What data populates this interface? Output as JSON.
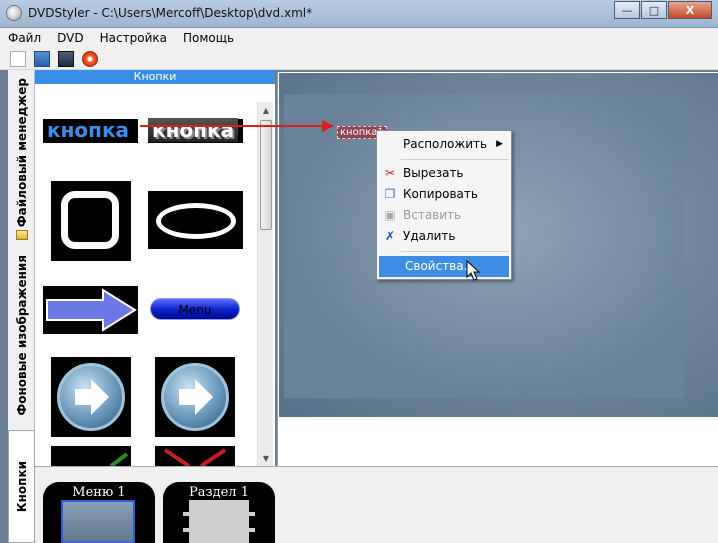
{
  "window": {
    "title": "DVDStyler - C:\\Users\\Mercoff\\Desktop\\dvd.xml*",
    "minimize": "—",
    "maximize": "□",
    "close": "X"
  },
  "menubar": [
    "Файл",
    "DVD",
    "Настройка",
    "Помощь"
  ],
  "toolbar": {
    "icons": [
      "new-icon",
      "open-icon",
      "save-icon",
      "burn-icon"
    ]
  },
  "side_tabs": {
    "file_manager": "Файловый менеджер",
    "backgrounds": "Фоновые изображения",
    "buttons": "Кнопки"
  },
  "buttons_panel": {
    "header": "Кнопки",
    "sample1": "кнопка",
    "sample2": "кнопка",
    "menu_button": "Menu"
  },
  "canvas": {
    "placed_button": "кнопка1"
  },
  "context_menu": {
    "items": [
      {
        "label": "Расположить",
        "icon": "",
        "has_submenu": true
      },
      {
        "label": "Вырезать",
        "icon": "scissors-icon"
      },
      {
        "label": "Копировать",
        "icon": "copy-icon"
      },
      {
        "label": "Вставить",
        "icon": "paste-icon",
        "disabled": true
      },
      {
        "label": "Удалить",
        "icon": "delete-icon"
      },
      {
        "label": "Свойства...",
        "icon": "",
        "highlighted": true
      }
    ]
  },
  "titleset": {
    "menu_title": "Меню 1",
    "chapter_title": "Раздел 1"
  },
  "colors": {
    "accent": "#3f8ee6",
    "arrow": "#d82020",
    "button_text_blue": "#3b8ee8"
  }
}
